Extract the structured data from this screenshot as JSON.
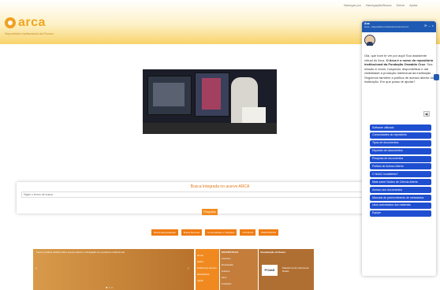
{
  "header": {
    "logo_text": "arca",
    "logo_sub": "Repositório Institucional da Fiocruz",
    "toplinks": [
      "Navegar por",
      "Navegação/Busca",
      "Sobre",
      "Ajuda"
    ]
  },
  "search": {
    "title": "Busca Integrada no acervo ARCA",
    "placeholder": "Digite o termo de busca",
    "button": "Pesquisar"
  },
  "nav": {
    "buttons": [
      "Busca Especializada",
      "Busca Reversa",
      "Comunidades e Coleções",
      "COVID-19",
      "PERIÓDICOS"
    ]
  },
  "news": {
    "text": "Fiocruz publica cartilha sobre acesso aberto e divulgação do repositório institucional",
    "dots": "● ○ ○",
    "prev": "‹",
    "next": "›"
  },
  "columns": {
    "a": [
      "Home",
      "Sobre",
      "Política de Acesso",
      "Estatísticas",
      "Ajuda"
    ],
    "b_head": "ESTATÍSTICAS",
    "b": [
      "Acessos",
      "Downloads",
      "Autores",
      "Itens",
      "Coleções"
    ],
    "c_head": "Visualização de Dados",
    "c_logo": "PCdaS",
    "c_text": "Plataforma de Ciência de Dados"
  },
  "chat": {
    "title": "Ana",
    "subtitle": "Arca – Repositório Institucional da Fiocruz",
    "controls": [
      "⟳",
      "–",
      "×"
    ],
    "message_pre": "Olá, que bom te ver por aqui! Sou assistente virtual do Arca. ",
    "message_bold": "O Arca é o nome do repositório institucional da Fundação Oswaldo Cruz",
    "message_post": ". Sua missão é reunir, hospedar, disponibilizar e dar visibilidade à produção intelectual da instituição. Seguimos também a política de acesso aberto da instituição. Em que posso te ajudar?",
    "speaker": "◀)",
    "options": [
      "Software utilizado",
      "Comunidades do repositório",
      "Tipos de documentos",
      "Depósito de documentos",
      "Pesquisa de documentos",
      "Política de Acesso Aberto",
      "O NAAC insatisfeito?",
      "Mais sobre Núcleo de Ciência Aberta",
      "Acesso aos documentos",
      "Manuais de preenchimento de metadados",
      "Usos autorizados dos materiais",
      "Equipe"
    ]
  }
}
